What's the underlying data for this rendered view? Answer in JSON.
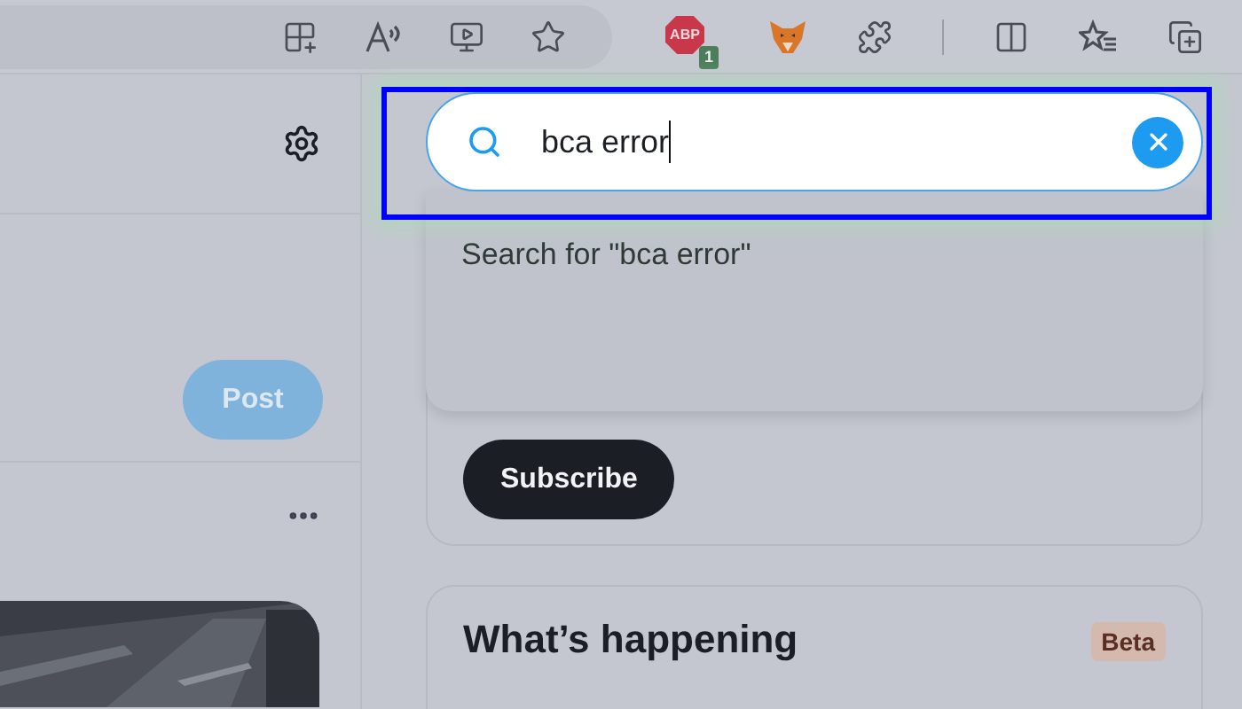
{
  "browser_toolbar": {
    "adblock": {
      "label": "ABP",
      "count": "1"
    }
  },
  "left_column": {
    "post_button": "Post"
  },
  "search": {
    "value": "bca error",
    "suggestion": "Search for \"bca error\""
  },
  "premium_card": {
    "subscribe_button": "Subscribe"
  },
  "trends": {
    "title": "What’s happening",
    "badge": "Beta"
  }
}
